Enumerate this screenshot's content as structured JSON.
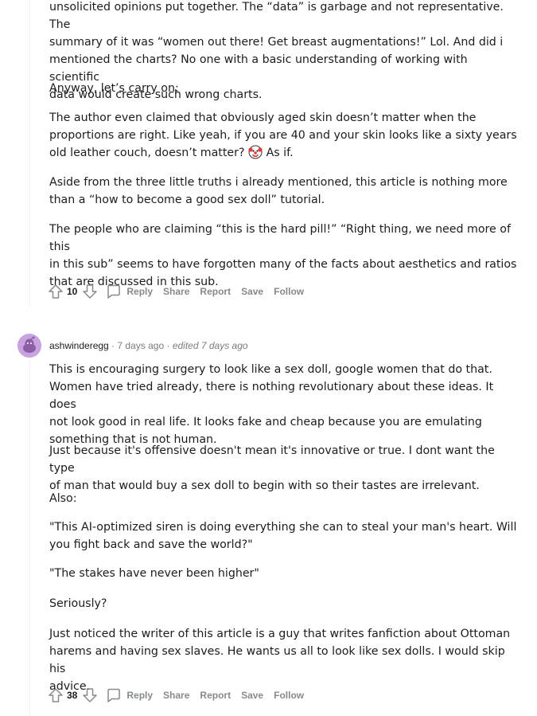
{
  "comment1": {
    "paragraphs": [
      {
        "lines": [
          "unsolicited opinions put together. The “data” is garbage and not representative. The",
          "summary of it was “women out there! Get breast augmentations!” Lol. And did i",
          "mentioned the charts? No one with a basic understanding of working with scientific",
          "data would create such wrong charts."
        ]
      },
      {
        "lines": [
          "Anyway, let’s carry on:"
        ]
      },
      {
        "lines": [
          "The author even claimed that obviously aged skin doesn’t matter when the",
          "proportions are right. Like yeah, if you are 40 and your skin looks like a sixty years"
        ],
        "line3_before": "old leather couch, doesn’t matter?",
        "line3_after": "As if."
      },
      {
        "lines": [
          "Aside from the three little truths i already mentioned, this article is nothing more",
          "than a “how to become a good sex doll” tutorial."
        ]
      },
      {
        "lines": [
          "The people who are claiming “this is the hard pill!” “Right thing, we need more of this",
          "in this sub” seems to have forgotten many of the facts about aesthetics and ratios",
          "that are discussed in this sub."
        ]
      }
    ],
    "votes": "10",
    "actions": {
      "reply": "Reply",
      "share": "Share",
      "report": "Report",
      "save": "Save",
      "follow": "Follow"
    }
  },
  "comment2": {
    "author": "ashwinderegg",
    "age": "7 days ago",
    "separator": "·",
    "edited": "edited 7 days ago",
    "paragraphs": [
      {
        "lines": [
          "This is encouraging surgery to look like a sex doll, google women that do that.",
          "Women have tried already, there is nothing revolutionary about these ideas. It does",
          "not look good in real life. It looks fake and cheap because you are emulating",
          "something that is not human."
        ]
      },
      {
        "lines": [
          "Just because it's offensive doesn't mean it's innovative or true. I dont want the type",
          "of man that would buy a sex doll to begin with so their tastes are irrelevant."
        ]
      },
      {
        "lines": [
          "Also:"
        ]
      },
      {
        "lines": [
          "\"This AI-optimized siren is doing everything she can to steal your man's heart. Will",
          "you fight back and save the world?\""
        ]
      },
      {
        "lines": [
          "\"The stakes have never been higher\""
        ]
      },
      {
        "lines": [
          "Seriously?"
        ]
      },
      {
        "lines": [
          "Just noticed the writer of this article is a guy that writes fanfiction about Ottoman",
          "harems and having sex slaves. He wants us all to look like sex dolls. I would skip his",
          "advice."
        ]
      }
    ],
    "votes": "38",
    "actions": {
      "reply": "Reply",
      "share": "Share",
      "report": "Report",
      "save": "Save",
      "follow": "Follow"
    }
  },
  "icons": {
    "upvote": "upvote-arrow-icon",
    "downvote": "downvote-arrow-icon",
    "reply": "comment-bubble-icon",
    "emoji": "clown-face-emoji-icon",
    "avatar": "snoo-avatar-icon"
  },
  "colors": {
    "text": "#1c1c1c",
    "muted": "#878a8c",
    "thread": "#edeff1",
    "avatar_bg": "#c9a3e0"
  }
}
